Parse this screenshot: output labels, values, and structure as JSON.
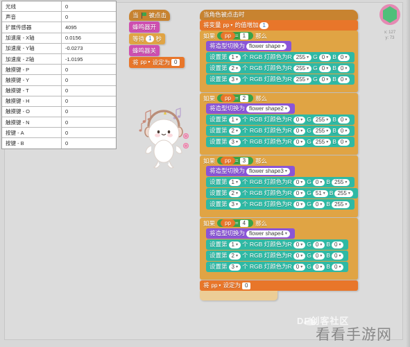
{
  "sensor_table": {
    "columns": [
      "name",
      "value"
    ],
    "rows": [
      {
        "name": "光线",
        "value": "0"
      },
      {
        "name": "声音",
        "value": "0"
      },
      {
        "name": "扩展传感器",
        "value": "4095"
      },
      {
        "name": "加速度 - X轴",
        "value": "0.0156"
      },
      {
        "name": "加速度 - Y轴",
        "value": "-0.0273"
      },
      {
        "name": "加速度 - Z轴",
        "value": "-1.0195"
      },
      {
        "name": "触摸键 - P",
        "value": "0"
      },
      {
        "name": "触摸键 - Y",
        "value": "0"
      },
      {
        "name": "触摸键 - T",
        "value": "0"
      },
      {
        "name": "触摸键 - H",
        "value": "0"
      },
      {
        "name": "触摸键 - O",
        "value": "0"
      },
      {
        "name": "触摸键 - N",
        "value": "0"
      },
      {
        "name": "按键 - A",
        "value": "0"
      },
      {
        "name": "按键 - B",
        "value": "0"
      }
    ]
  },
  "script_left": {
    "hat": "被点击",
    "blocks": [
      {
        "label": "蜂鸣器开"
      },
      {
        "label_pre": "等待",
        "value": "1",
        "label_post": "秒"
      },
      {
        "label": "蜂鸣器关"
      },
      {
        "label_pre": "将",
        "var": "pp",
        "label_mid": "设定为",
        "value": "0"
      }
    ]
  },
  "script_right": {
    "hat": "当角色被点击时",
    "change_var": {
      "pre": "将变量",
      "var": "pp",
      "post": "的值增加",
      "value": "1"
    },
    "groups": [
      {
        "if_pre": "如果",
        "cond_var": "pp",
        "cond_op": "=",
        "cond_val": "1",
        "if_post": "那么",
        "costume_label": "将造型切换为",
        "costume": "flower shape",
        "rgb": [
          {
            "pre": "设置第",
            "index": "1",
            "mid": "个 RGB 灯颜色为",
            "r": "255",
            "g": "0",
            "b": "0"
          },
          {
            "pre": "设置第",
            "index": "2",
            "mid": "个 RGB 灯颜色为",
            "r": "255",
            "g": "0",
            "b": "0"
          },
          {
            "pre": "设置第",
            "index": "3",
            "mid": "个 RGB 灯颜色为",
            "r": "255",
            "g": "0",
            "b": "0"
          }
        ]
      },
      {
        "if_pre": "如果",
        "cond_var": "pp",
        "cond_op": "=",
        "cond_val": "2",
        "if_post": "那么",
        "costume_label": "将造型切换为",
        "costume": "flower shape2",
        "rgb": [
          {
            "pre": "设置第",
            "index": "1",
            "mid": "个 RGB 灯颜色为",
            "r": "0",
            "g": "255",
            "b": "0"
          },
          {
            "pre": "设置第",
            "index": "2",
            "mid": "个 RGB 灯颜色为",
            "r": "0",
            "g": "255",
            "b": "0"
          },
          {
            "pre": "设置第",
            "index": "3",
            "mid": "个 RGB 灯颜色为",
            "r": "0",
            "g": "255",
            "b": "0"
          }
        ]
      },
      {
        "if_pre": "如果",
        "cond_var": "pp",
        "cond_op": "=",
        "cond_val": "3",
        "if_post": "那么",
        "costume_label": "将造型切换为",
        "costume": "flower shape3",
        "rgb": [
          {
            "pre": "设置第",
            "index": "1",
            "mid": "个 RGB 灯颜色为",
            "r": "0",
            "g": "0",
            "b": "255"
          },
          {
            "pre": "设置第",
            "index": "2",
            "mid": "个 RGB 灯颜色为",
            "r": "0",
            "g": "51",
            "b": "255"
          },
          {
            "pre": "设置第",
            "index": "3",
            "mid": "个 RGB 灯颜色为",
            "r": "0",
            "g": "0",
            "b": "255"
          }
        ]
      },
      {
        "if_pre": "如果",
        "cond_var": "pp",
        "cond_op": "=",
        "cond_val": "4",
        "if_post": "那么",
        "costume_label": "将造型切换为",
        "costume": "flower shape4",
        "rgb": [
          {
            "pre": "设置第",
            "index": "1",
            "mid": "个 RGB 灯颜色为",
            "r": "0",
            "g": "0",
            "b": "0"
          },
          {
            "pre": "设置第",
            "index": "2",
            "mid": "个 RGB 灯颜色为",
            "r": "0",
            "g": "0",
            "b": "0"
          },
          {
            "pre": "设置第",
            "index": "3",
            "mid": "个 RGB 灯颜色为",
            "r": "0",
            "g": "0",
            "b": "0"
          }
        ]
      }
    ],
    "reset": {
      "pre": "将",
      "var": "pp",
      "mid": "设定为",
      "value": "0"
    },
    "labels": {
      "r": "R",
      "g": "G",
      "b": "B"
    }
  },
  "sprite_thumb": {
    "x_label": "x: 127",
    "y_label": "y: 73"
  },
  "watermarks": {
    "brand": "DF创客社区",
    "site": "看看手游网"
  },
  "colors": {
    "events": "#c88330",
    "control": "#e0a444",
    "variables": "#e8762a",
    "looks": "#8a55d7",
    "rgb_block": "#2fb9a4",
    "operator": "#3aa24a"
  }
}
